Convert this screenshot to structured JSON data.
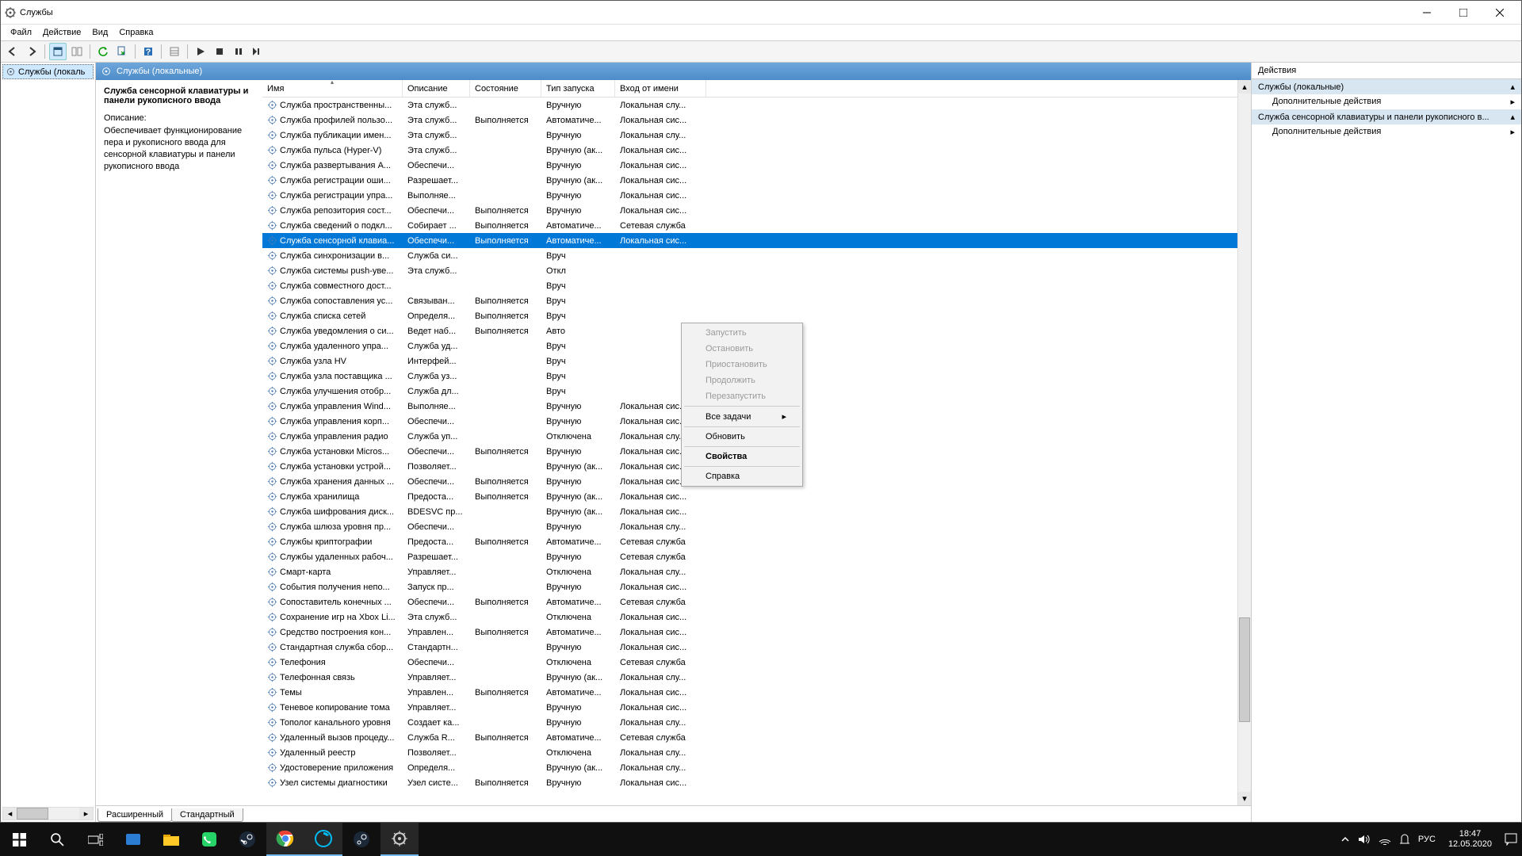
{
  "window": {
    "title": "Службы",
    "menu": [
      "Файл",
      "Действие",
      "Вид",
      "Справка"
    ]
  },
  "tree": {
    "root": "Службы (локаль"
  },
  "center_header": "Службы (локальные)",
  "detail": {
    "title": "Служба сенсорной клавиатуры и панели рукописного ввода",
    "desc_label": "Описание:",
    "desc": "Обеспечивает функционирование пера и рукописного ввода для сенсорной клавиатуры и панели рукописного ввода"
  },
  "columns": [
    "Имя",
    "Описание",
    "Состояние",
    "Тип запуска",
    "Вход от имени"
  ],
  "services": [
    {
      "n": "Служба пространственны...",
      "d": "Эта служб...",
      "s": "",
      "t": "Вручную",
      "l": "Локальная слу..."
    },
    {
      "n": "Служба профилей пользо...",
      "d": "Эта служб...",
      "s": "Выполняется",
      "t": "Автоматиче...",
      "l": "Локальная сис..."
    },
    {
      "n": "Служба публикации имен...",
      "d": "Эта служб...",
      "s": "",
      "t": "Вручную",
      "l": "Локальная слу..."
    },
    {
      "n": "Служба пульса (Hyper-V)",
      "d": "Эта служб...",
      "s": "",
      "t": "Вручную (ак...",
      "l": "Локальная сис..."
    },
    {
      "n": "Служба развертывания A...",
      "d": "Обеспечи...",
      "s": "",
      "t": "Вручную",
      "l": "Локальная сис..."
    },
    {
      "n": "Служба регистрации оши...",
      "d": "Разрешает...",
      "s": "",
      "t": "Вручную (ак...",
      "l": "Локальная сис..."
    },
    {
      "n": "Служба регистрации упра...",
      "d": "Выполняе...",
      "s": "",
      "t": "Вручную",
      "l": "Локальная сис..."
    },
    {
      "n": "Служба репозитория сост...",
      "d": "Обеспечи...",
      "s": "Выполняется",
      "t": "Вручную",
      "l": "Локальная сис..."
    },
    {
      "n": "Служба сведений о подкл...",
      "d": "Собирает ...",
      "s": "Выполняется",
      "t": "Автоматиче...",
      "l": "Сетевая служба"
    },
    {
      "n": "Служба сенсорной клавиа...",
      "d": "Обеспечи...",
      "s": "Выполняется",
      "t": "Автоматиче...",
      "l": "Локальная сис...",
      "sel": true
    },
    {
      "n": "Служба синхронизации в...",
      "d": "Служба си...",
      "s": "",
      "t": "Вруч",
      "l": ""
    },
    {
      "n": "Служба системы push-уве...",
      "d": "Эта служб...",
      "s": "",
      "t": "Откл",
      "l": ""
    },
    {
      "n": "Служба совместного дост...",
      "d": "",
      "s": "",
      "t": "Вруч",
      "l": ""
    },
    {
      "n": "Служба сопоставления ус...",
      "d": "Связыван...",
      "s": "Выполняется",
      "t": "Вруч",
      "l": ""
    },
    {
      "n": "Служба списка сетей",
      "d": "Определя...",
      "s": "Выполняется",
      "t": "Вруч",
      "l": ""
    },
    {
      "n": "Служба уведомления о си...",
      "d": "Ведет наб...",
      "s": "Выполняется",
      "t": "Авто",
      "l": ""
    },
    {
      "n": "Служба удаленного упра...",
      "d": "Служба уд...",
      "s": "",
      "t": "Вруч",
      "l": ""
    },
    {
      "n": "Служба узла HV",
      "d": "Интерфей...",
      "s": "",
      "t": "Вруч",
      "l": ""
    },
    {
      "n": "Служба узла поставщика ...",
      "d": "Служба уз...",
      "s": "",
      "t": "Вруч",
      "l": ""
    },
    {
      "n": "Служба улучшения отобр...",
      "d": "Служба дл...",
      "s": "",
      "t": "Вруч",
      "l": ""
    },
    {
      "n": "Служба управления Wind...",
      "d": "Выполняе...",
      "s": "",
      "t": "Вручную",
      "l": "Локальная сис..."
    },
    {
      "n": "Служба управления корп...",
      "d": "Обеспечи...",
      "s": "",
      "t": "Вручную",
      "l": "Локальная сис..."
    },
    {
      "n": "Служба управления радио",
      "d": "Служба уп...",
      "s": "",
      "t": "Отключена",
      "l": "Локальная слу..."
    },
    {
      "n": "Служба установки Micros...",
      "d": "Обеспечи...",
      "s": "Выполняется",
      "t": "Вручную",
      "l": "Локальная сис..."
    },
    {
      "n": "Служба установки устрой...",
      "d": "Позволяет...",
      "s": "",
      "t": "Вручную (ак...",
      "l": "Локальная сис..."
    },
    {
      "n": "Служба хранения данных ...",
      "d": "Обеспечи...",
      "s": "Выполняется",
      "t": "Вручную",
      "l": "Локальная сис..."
    },
    {
      "n": "Служба хранилища",
      "d": "Предоста...",
      "s": "Выполняется",
      "t": "Вручную (ак...",
      "l": "Локальная сис..."
    },
    {
      "n": "Служба шифрования диск...",
      "d": "BDESVC пр...",
      "s": "",
      "t": "Вручную (ак...",
      "l": "Локальная сис..."
    },
    {
      "n": "Служба шлюза уровня пр...",
      "d": "Обеспечи...",
      "s": "",
      "t": "Вручную",
      "l": "Локальная слу..."
    },
    {
      "n": "Службы криптографии",
      "d": "Предоста...",
      "s": "Выполняется",
      "t": "Автоматиче...",
      "l": "Сетевая служба"
    },
    {
      "n": "Службы удаленных рабоч...",
      "d": "Разрешает...",
      "s": "",
      "t": "Вручную",
      "l": "Сетевая служба"
    },
    {
      "n": "Смарт-карта",
      "d": "Управляет...",
      "s": "",
      "t": "Отключена",
      "l": "Локальная слу..."
    },
    {
      "n": "События получения непо...",
      "d": "Запуск пр...",
      "s": "",
      "t": "Вручную",
      "l": "Локальная сис..."
    },
    {
      "n": "Сопоставитель конечных ...",
      "d": "Обеспечи...",
      "s": "Выполняется",
      "t": "Автоматиче...",
      "l": "Сетевая служба"
    },
    {
      "n": "Сохранение игр на Xbox Li...",
      "d": "Эта служб...",
      "s": "",
      "t": "Отключена",
      "l": "Локальная сис..."
    },
    {
      "n": "Средство построения кон...",
      "d": "Управлен...",
      "s": "Выполняется",
      "t": "Автоматиче...",
      "l": "Локальная сис..."
    },
    {
      "n": "Стандартная служба сбор...",
      "d": "Стандартн...",
      "s": "",
      "t": "Вручную",
      "l": "Локальная сис..."
    },
    {
      "n": "Телефония",
      "d": "Обеспечи...",
      "s": "",
      "t": "Отключена",
      "l": "Сетевая служба"
    },
    {
      "n": "Телефонная связь",
      "d": "Управляет...",
      "s": "",
      "t": "Вручную (ак...",
      "l": "Локальная слу..."
    },
    {
      "n": "Темы",
      "d": "Управлен...",
      "s": "Выполняется",
      "t": "Автоматиче...",
      "l": "Локальная сис..."
    },
    {
      "n": "Теневое копирование тома",
      "d": "Управляет...",
      "s": "",
      "t": "Вручную",
      "l": "Локальная сис..."
    },
    {
      "n": "Тополог канального уровня",
      "d": "Создает ка...",
      "s": "",
      "t": "Вручную",
      "l": "Локальная слу..."
    },
    {
      "n": "Удаленный вызов процеду...",
      "d": "Служба R...",
      "s": "Выполняется",
      "t": "Автоматиче...",
      "l": "Сетевая служба"
    },
    {
      "n": "Удаленный реестр",
      "d": "Позволяет...",
      "s": "",
      "t": "Отключена",
      "l": "Локальная слу..."
    },
    {
      "n": "Удостоверение приложения",
      "d": "Определя...",
      "s": "",
      "t": "Вручную (ак...",
      "l": "Локальная слу..."
    },
    {
      "n": "Узел системы диагностики",
      "d": "Узел систе...",
      "s": "Выполняется",
      "t": "Вручную",
      "l": "Локальная сис..."
    }
  ],
  "context_menu": {
    "start": "Запустить",
    "stop": "Остановить",
    "pause": "Приостановить",
    "resume": "Продолжить",
    "restart": "Перезапустить",
    "all_tasks": "Все задачи",
    "refresh": "Обновить",
    "properties": "Свойства",
    "help": "Справка"
  },
  "tabs": {
    "ext": "Расширенный",
    "std": "Стандартный"
  },
  "actions": {
    "title": "Действия",
    "group1": "Службы (локальные)",
    "more": "Дополнительные действия",
    "group2": "Служба сенсорной клавиатуры и панели рукописного в..."
  },
  "tray": {
    "lang": "РУС",
    "time": "18:47",
    "date": "12.05.2020"
  }
}
